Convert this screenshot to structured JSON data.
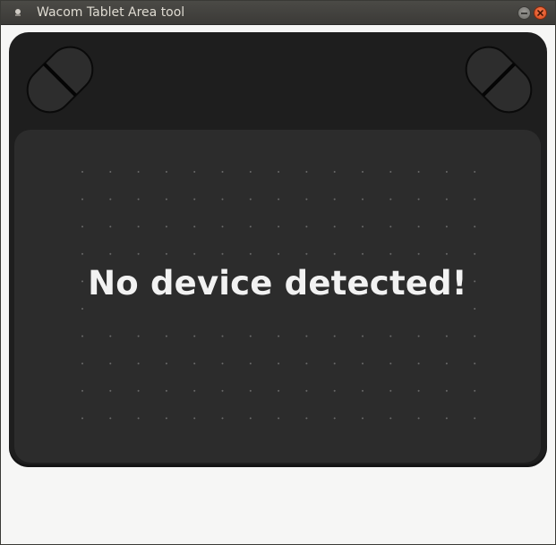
{
  "window": {
    "title": "Wacom Tablet Area tool",
    "controls": {
      "minimize_icon": "minimize-icon",
      "close_icon": "close-icon"
    }
  },
  "tablet": {
    "message": "No device detected!",
    "colors": {
      "body": "#1e1e1e",
      "active_area": "#2c2c2c",
      "dots": "#6a6a6a",
      "message": "#f2f2f2"
    },
    "express_keys": [
      "express-key-left",
      "express-key-right"
    ]
  }
}
